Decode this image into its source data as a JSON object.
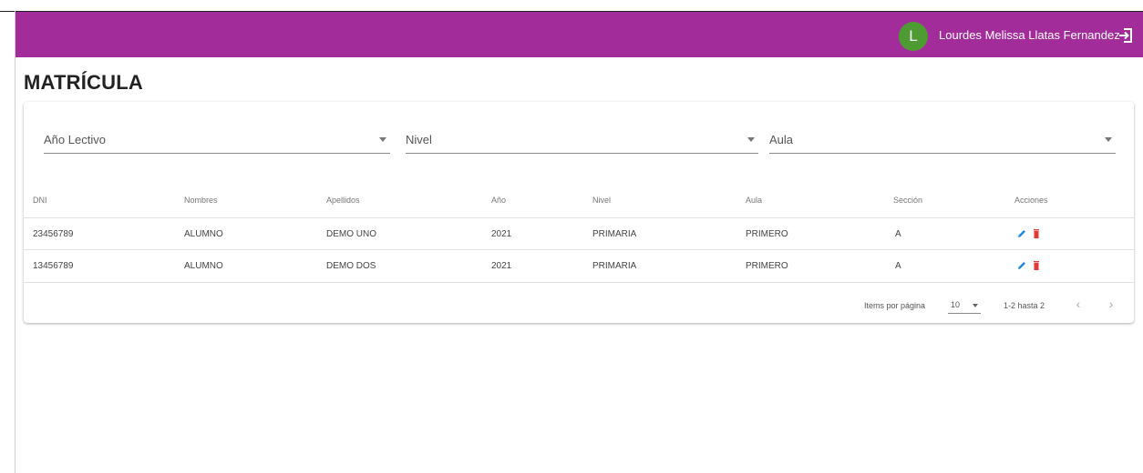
{
  "header": {
    "avatar_initial": "L",
    "user_name": "Lourdes Melissa Llatas Fernandez",
    "bar_color": "#a12c9a",
    "avatar_color": "#4f9b33",
    "logout_icon": "logout-icon"
  },
  "page": {
    "title": "MATRÍCULA"
  },
  "filters": {
    "year_label": "Año Lectivo",
    "level_label": "Nivel",
    "classroom_label": "Aula"
  },
  "table": {
    "columns": [
      "DNI",
      "Nombres",
      "Apellidos",
      "Año",
      "Nivel",
      "Aula",
      "Sección",
      "Acciones"
    ],
    "rows": [
      {
        "dni": "23456789",
        "nombres": "ALUMNO",
        "apellidos": "DEMO UNO",
        "anio": "2021",
        "nivel": "PRIMARIA",
        "aula": "PRIMERO",
        "seccion": "A"
      },
      {
        "dni": "13456789",
        "nombres": "ALUMNO",
        "apellidos": "DEMO DOS",
        "anio": "2021",
        "nivel": "PRIMARIA",
        "aula": "PRIMERO",
        "seccion": "A"
      }
    ],
    "edit_color": "#1e88e5",
    "delete_color": "#e53935"
  },
  "paginator": {
    "items_label": "Items por página",
    "page_size": "10",
    "range_label": "1-2 hasta 2",
    "prev_symbol": "‹",
    "next_symbol": "›"
  }
}
